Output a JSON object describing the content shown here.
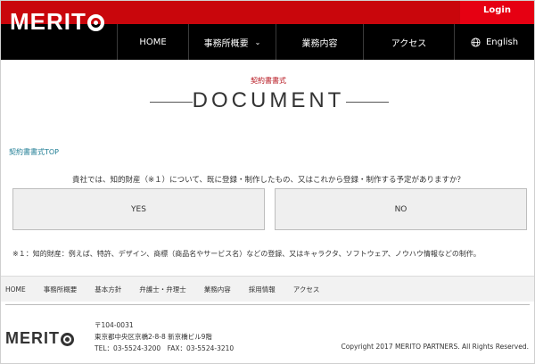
{
  "header": {
    "logo": "MERIT",
    "login_label": "Login",
    "nav": [
      {
        "label": "HOME"
      },
      {
        "label": "事務所概要"
      },
      {
        "label": "業務内容"
      },
      {
        "label": "アクセス"
      },
      {
        "label": "English"
      }
    ]
  },
  "page": {
    "kicker": "契約書書式",
    "title": "DOCUMENT",
    "breadcrumb": "契約書書式TOP",
    "question": "貴社では、知的財産（※１）について、既に登録・制作したもの、又はこれから登録・制作する予定がありますか？",
    "yes_label": "YES",
    "no_label": "NO",
    "note": "※１：知的財産：例えば、特許、デザイン、商標（商品名やサービス名）などの登録、又はキャラクタ、ソフトウェア、ノウハウ情報などの制作。"
  },
  "footer": {
    "nav": [
      "HOME",
      "事務所概要",
      "基本方針",
      "弁護士・弁理士",
      "業務内容",
      "採用情報",
      "アクセス"
    ],
    "logo": "MERIT",
    "postal": "〒104-0031",
    "address": "東京都中央区京橋2-8-8 新京橋ビル9階",
    "phone": "TEL：03-5524-3200　FAX：03-5524-3210",
    "copyright": "Copyright 2017 MERITO PARTNERS. All Rights Reserved."
  },
  "colors": {
    "brand_red": "#c9060c",
    "login_red": "#e60012",
    "link": "#217e95"
  }
}
